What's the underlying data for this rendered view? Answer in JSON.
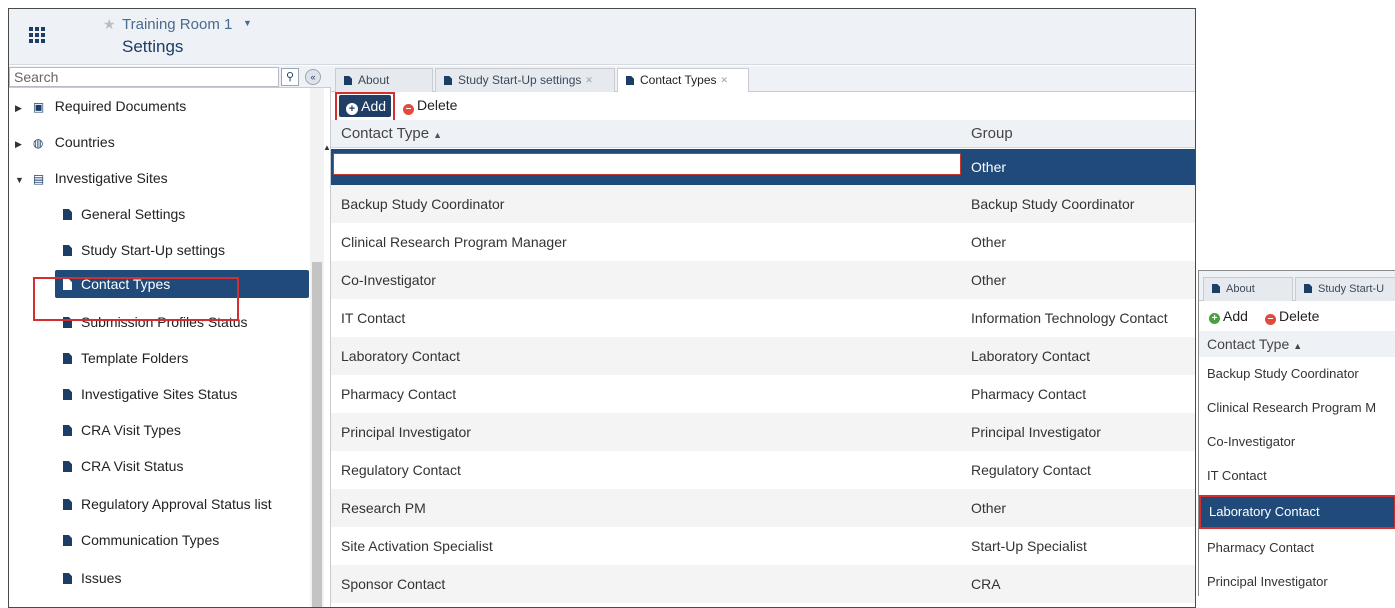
{
  "header": {
    "room_name": "Training Room 1",
    "page_title": "Settings"
  },
  "sidebar": {
    "search_placeholder": "Search",
    "items": [
      {
        "label": "Required Documents"
      },
      {
        "label": "Countries"
      },
      {
        "label": "Investigative Sites"
      },
      {
        "label": "General Settings"
      },
      {
        "label": "Study Start-Up settings"
      },
      {
        "label": "Contact Types",
        "selected": true
      },
      {
        "label": "Submission Profiles Status"
      },
      {
        "label": "Template Folders"
      },
      {
        "label": "Investigative Sites Status"
      },
      {
        "label": "CRA Visit Types"
      },
      {
        "label": "CRA Visit Status"
      },
      {
        "label": "Regulatory Approval Status list"
      },
      {
        "label": "Communication Types"
      },
      {
        "label": "Issues"
      }
    ]
  },
  "tabs": [
    {
      "label": "About"
    },
    {
      "label": "Study Start-Up settings"
    },
    {
      "label": "Contact Types",
      "active": true
    }
  ],
  "toolbar": {
    "add_label": "Add",
    "delete_label": "Delete"
  },
  "grid": {
    "columns": [
      "Contact Type",
      "Group"
    ],
    "new_row": {
      "contact_type": "",
      "group": "Other"
    },
    "rows": [
      {
        "contact_type": "Backup Study Coordinator",
        "group": "Backup Study Coordinator"
      },
      {
        "contact_type": "Clinical Research Program Manager",
        "group": "Other"
      },
      {
        "contact_type": "Co-Investigator",
        "group": "Other"
      },
      {
        "contact_type": "IT Contact",
        "group": "Information Technology Contact"
      },
      {
        "contact_type": "Laboratory Contact",
        "group": "Laboratory Contact"
      },
      {
        "contact_type": "Pharmacy Contact",
        "group": "Pharmacy Contact"
      },
      {
        "contact_type": "Principal Investigator",
        "group": "Principal Investigator"
      },
      {
        "contact_type": "Regulatory Contact",
        "group": "Regulatory Contact"
      },
      {
        "contact_type": "Research PM",
        "group": "Other"
      },
      {
        "contact_type": "Site Activation Specialist",
        "group": "Start-Up Specialist"
      },
      {
        "contact_type": "Sponsor Contact",
        "group": "CRA"
      }
    ]
  },
  "inset": {
    "tabs": [
      "About",
      "Study Start-U"
    ],
    "add_label": "Add",
    "delete_label": "Delete",
    "column": "Contact Type",
    "rows": [
      {
        "label": "Backup Study Coordinator"
      },
      {
        "label": "Clinical Research Program M"
      },
      {
        "label": "Co-Investigator"
      },
      {
        "label": "IT Contact"
      },
      {
        "label": "Laboratory Contact",
        "selected": true
      },
      {
        "label": "Pharmacy Contact"
      },
      {
        "label": "Principal Investigator"
      }
    ]
  },
  "colors": {
    "accent_navy": "#1f4a7a",
    "highlight_red": "#d32f2f",
    "delete_red": "#e04b3c",
    "add_green": "#4aa03f"
  }
}
